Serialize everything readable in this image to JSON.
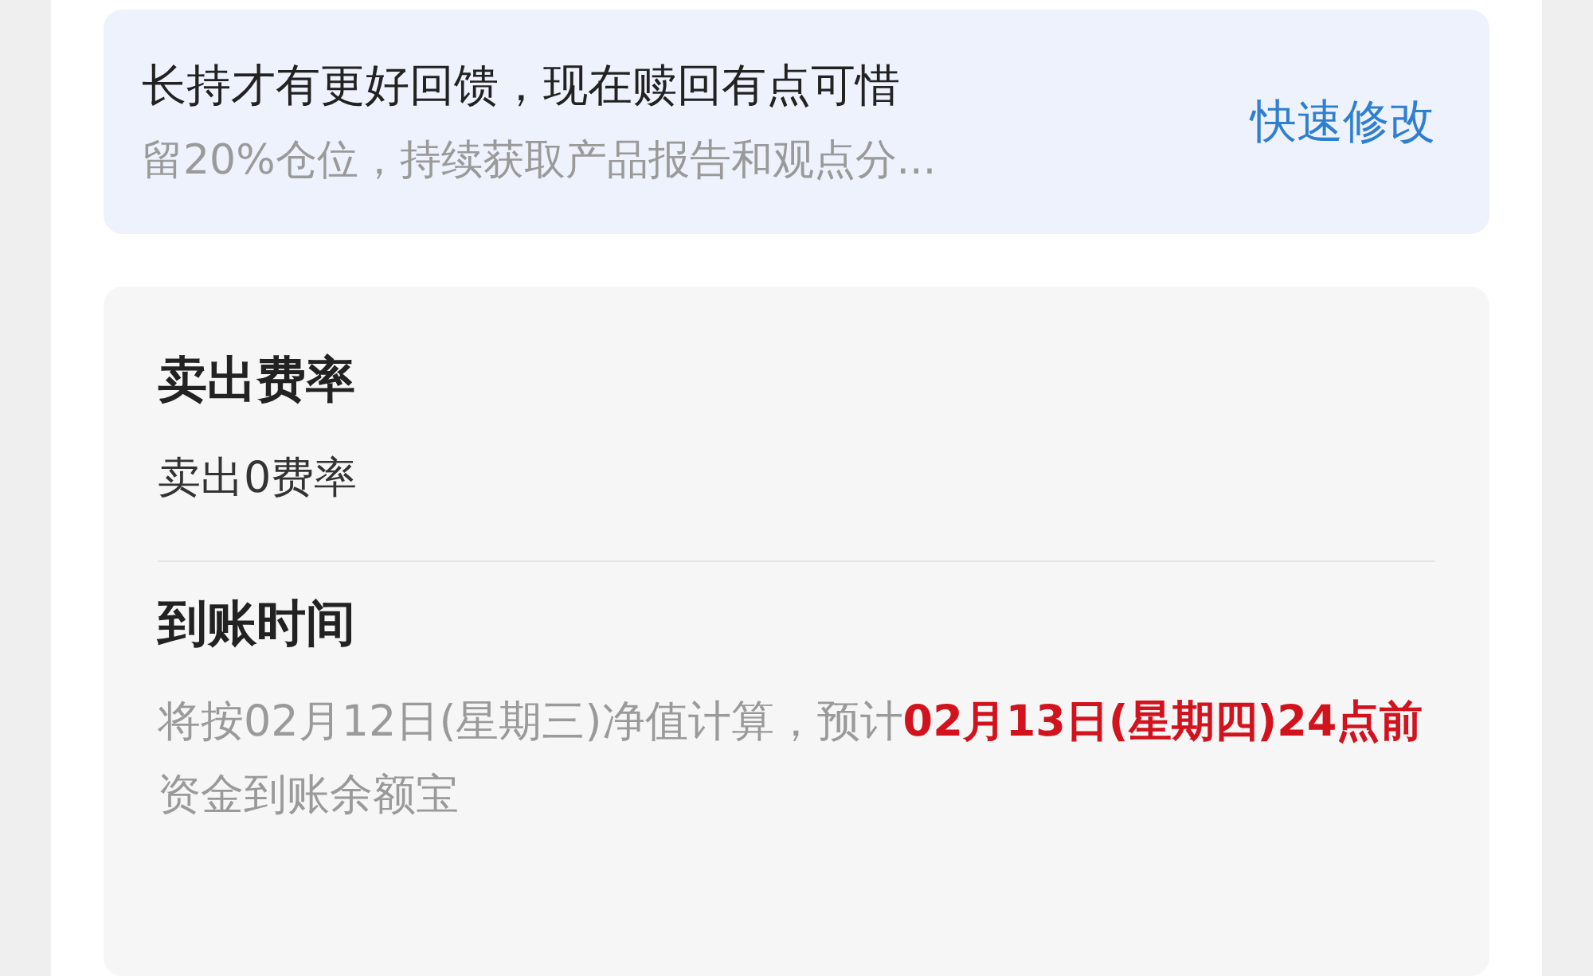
{
  "retain_banner": {
    "title": "长持才有更好回馈，现在赎回有点可惜",
    "subtitle": "留20%仓位，持续获取产品报告和观点分...",
    "action": "快速修改"
  },
  "info_sections": [
    {
      "heading": "卖出费率",
      "body": "卖出0费率"
    },
    {
      "heading": "到账时间",
      "body": "将按02月12日(星期三)净值计算，预计**02月13日(星期四)24点前**资金到账余额宝"
    }
  ]
}
